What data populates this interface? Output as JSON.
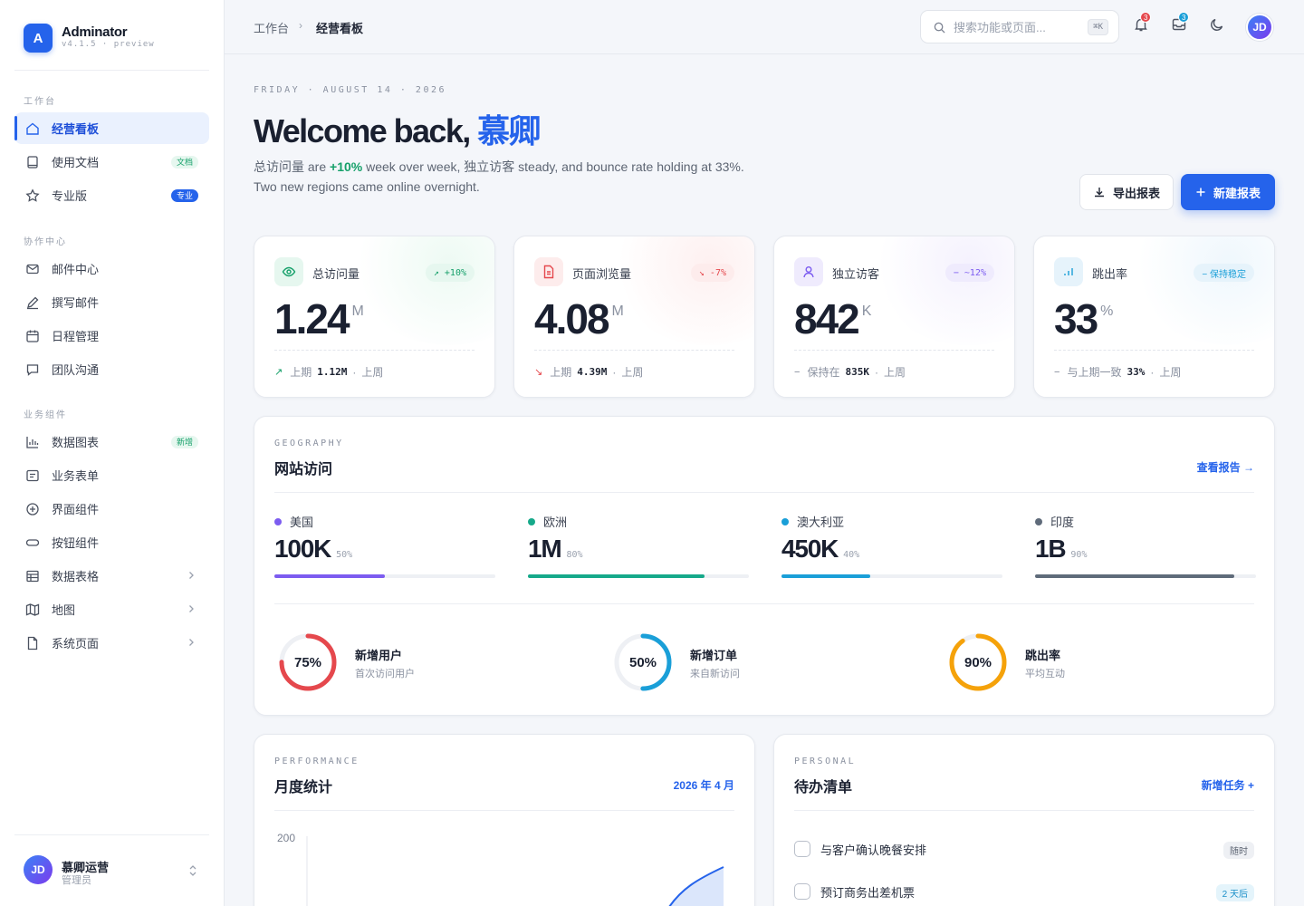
{
  "brand": {
    "logo": "A",
    "name": "Adminator",
    "version": "v4.1.5 · preview"
  },
  "sidebar": {
    "sections": [
      {
        "label": "工作台"
      },
      {
        "label": "协作中心"
      },
      {
        "label": "业务组件"
      }
    ],
    "items": [
      {
        "label": "经营看板",
        "icon": "home-icon"
      },
      {
        "label": "使用文档",
        "icon": "book-icon",
        "badge": "文档"
      },
      {
        "label": "专业版",
        "icon": "star-icon",
        "badge": "专业"
      },
      {
        "label": "邮件中心",
        "icon": "mail-icon"
      },
      {
        "label": "撰写邮件",
        "icon": "pen-icon"
      },
      {
        "label": "日程管理",
        "icon": "calendar-icon"
      },
      {
        "label": "团队沟通",
        "icon": "chat-icon"
      },
      {
        "label": "数据图表",
        "icon": "chart-icon",
        "badge": "新增"
      },
      {
        "label": "业务表单",
        "icon": "form-icon"
      },
      {
        "label": "界面组件",
        "icon": "plus-circle-icon"
      },
      {
        "label": "按钮组件",
        "icon": "button-icon"
      },
      {
        "label": "数据表格",
        "icon": "table-icon"
      },
      {
        "label": "地图",
        "icon": "map-icon"
      },
      {
        "label": "系统页面",
        "icon": "file-icon"
      }
    ],
    "user": {
      "initials": "JD",
      "name": "慕卿运营",
      "role": "管理员"
    }
  },
  "topbar": {
    "breadcrumb": [
      "工作台",
      "经营看板"
    ],
    "search_placeholder": "搜索功能或页面...",
    "search_shortcut": "⌘K",
    "notifications_count": "3",
    "messages_count": "3",
    "avatar": "JD"
  },
  "header": {
    "date": "FRIDAY · AUGUST 14 · 2026",
    "welcome_prefix": "Welcome back, ",
    "welcome_name": "慕卿",
    "intro_a": "总访问量 are ",
    "intro_up": "+10%",
    "intro_b": " week over week, 独立访客 steady, and bounce rate holding at 33%. Two new regions came online overnight.",
    "export_label": "导出报表",
    "new_label": "新建报表"
  },
  "stats": [
    {
      "label": "总访问量",
      "chip": "↗ +10%",
      "value": "1.24",
      "unit": "M",
      "arrow": "↗",
      "prefix": "上期",
      "prev": "1.12M",
      "suffix": "上周",
      "color": "#16a06a"
    },
    {
      "label": "页面浏览量",
      "chip": "↘ -7%",
      "value": "4.08",
      "unit": "M",
      "arrow": "↘",
      "prefix": "上期",
      "prev": "4.39M",
      "suffix": "上周",
      "color": "#e5484d"
    },
    {
      "label": "独立访客",
      "chip": "− ~12%",
      "value": "842",
      "unit": "K",
      "arrow": "−",
      "prefix": "保持在",
      "prev": "835K",
      "suffix": "上周",
      "color": "#7c5cf0"
    },
    {
      "label": "跳出率",
      "chip": "− 保持稳定",
      "value": "33",
      "unit": "%",
      "arrow": "−",
      "prefix": "与上期一致",
      "prev": "33%",
      "suffix": "上周",
      "color": "#1a9fd8"
    }
  ],
  "geography": {
    "kicker": "GEOGRAPHY",
    "title": "网站访问",
    "link": "查看报告",
    "regions": [
      {
        "name": "美国",
        "value": "100K",
        "pct": "50%",
        "fill": 0.5,
        "color": "#7c5cf0"
      },
      {
        "name": "欧洲",
        "value": "1M",
        "pct": "80%",
        "fill": 0.8,
        "color": "#16a98a"
      },
      {
        "name": "澳大利亚",
        "value": "450K",
        "pct": "40%",
        "fill": 0.4,
        "color": "#1a9fd8"
      },
      {
        "name": "印度",
        "value": "1B",
        "pct": "90%",
        "fill": 0.9,
        "color": "#5f6b7a"
      }
    ],
    "rings": [
      {
        "value": "75%",
        "fill": 0.75,
        "title": "新增用户",
        "sub": "首次访问用户",
        "color": "#e5484d"
      },
      {
        "value": "50%",
        "fill": 0.5,
        "title": "新增订单",
        "sub": "来自新访问",
        "color": "#1a9fd8"
      },
      {
        "value": "90%",
        "fill": 0.9,
        "title": "跳出率",
        "sub": "平均互动",
        "color": "#f5a20a"
      }
    ]
  },
  "performance": {
    "kicker": "PERFORMANCE",
    "title": "月度统计",
    "period": "2026 年 4 月",
    "y_tick": "200"
  },
  "todo": {
    "kicker": "PERSONAL",
    "title": "待办清单",
    "link": "新增任务",
    "items": [
      {
        "text": "与客户确认晚餐安排",
        "badge": "随时",
        "badge_bg": "#eef0f4",
        "badge_color": "#5d6573"
      },
      {
        "text": "预订商务出差机票",
        "badge": "2 天后",
        "badge_bg": "#e4f4fb",
        "badge_color": "#1a8fc8"
      }
    ]
  }
}
